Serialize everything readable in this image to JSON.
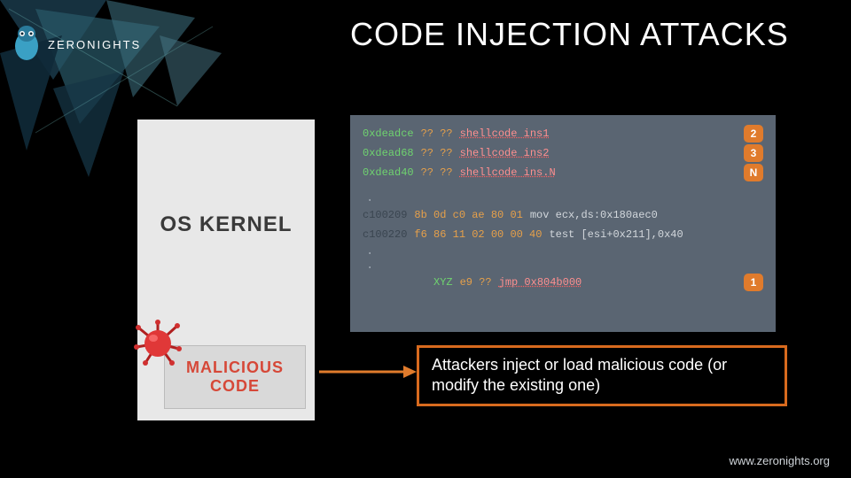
{
  "brand": {
    "name": "ZERONIGHTS",
    "url": "www.zeronights.org"
  },
  "title": "CODE INJECTION ATTACKS",
  "left": {
    "kernel_label": "OS KERNEL",
    "malicious_l1": "MALICIOUS",
    "malicious_l2": "CODE"
  },
  "code": {
    "rows": [
      {
        "addr": "0xdeadce",
        "addr_cls": "addr-green",
        "bytes": "?? ??",
        "asm": "shellcode ins1",
        "asm_cls": "asm-red",
        "badge": "2"
      },
      {
        "addr": "0xdead68",
        "addr_cls": "addr-green",
        "bytes": "?? ??",
        "asm": "shellcode ins2",
        "asm_cls": "asm-red",
        "badge": "3"
      },
      {
        "addr": "0xdead40",
        "addr_cls": "addr-green",
        "bytes": "?? ??",
        "asm": "shellcode ins.N",
        "asm_cls": "asm-red",
        "badge": "N"
      }
    ],
    "rows2": [
      {
        "addr": "c100209",
        "addr_cls": "addr-faint",
        "bytes": "8b 0d c0 ae 80 01",
        "asm": "mov ecx,ds:0x180aec0",
        "asm_cls": "asm"
      },
      {
        "addr": "c100220",
        "addr_cls": "addr-faint",
        "bytes": "f6 86 11 02 00 00 40",
        "asm": "test [esi+0x211],0x40",
        "asm_cls": "asm"
      }
    ],
    "jmp": {
      "addr": "XYZ",
      "addr_cls": "addr-green",
      "bytes": "e9 ??",
      "asm": "jmp 0x804b000",
      "asm_cls": "asm-red",
      "badge": "1"
    }
  },
  "callout": "Attackers inject or load malicious code (or modify the existing one)"
}
